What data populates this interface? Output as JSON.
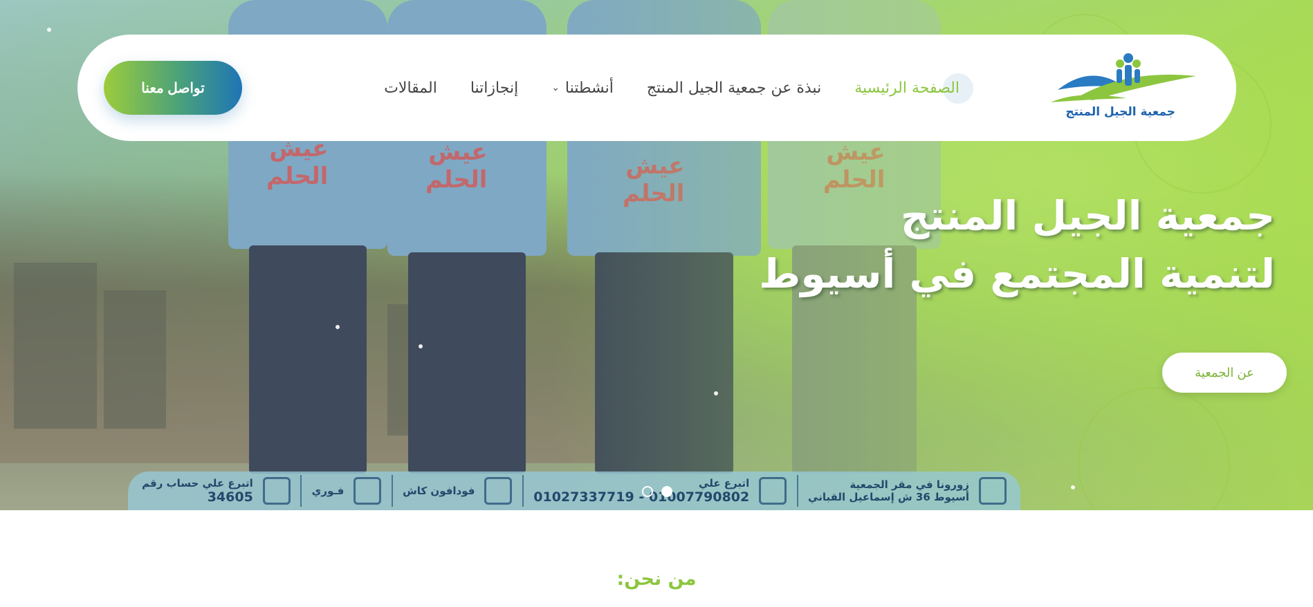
{
  "logo": {
    "text": "جمعية الجيل المنتج"
  },
  "nav": {
    "items": [
      {
        "label": "الصفحة الرئيسية",
        "active": true
      },
      {
        "label": "نبذة عن جمعية الجيل المنتج"
      },
      {
        "label": "أنشطتنا",
        "has_dropdown": true
      },
      {
        "label": "إنجازاتنا"
      },
      {
        "label": "المقالات"
      }
    ],
    "contact_button": "تواصل معنا"
  },
  "hero": {
    "title_line1": "جمعية الجيل المنتج",
    "title_line2": "لتنمية المجتمع في أسيوط",
    "about_button": "عن الجمعية",
    "slides_total": 2,
    "active_slide": 1,
    "shirt_text": "عيش الحلم"
  },
  "banner": {
    "visit_title": "زورونا في مقر الجمعية",
    "visit_address": "أسيوط 36 ش إسماعيل القباني",
    "donate_title": "اتبرع علي",
    "donate_numbers": "01007790802 - 01027337719",
    "vodafone": "فودافون كاش",
    "fawry": "فـوري",
    "account_title": "اتبرع علي حساب رقم",
    "account_number": "34605"
  },
  "section": {
    "title": "من نحن:"
  },
  "colors": {
    "brand_green": "#8cc63f",
    "brand_blue": "#1e75b5"
  }
}
